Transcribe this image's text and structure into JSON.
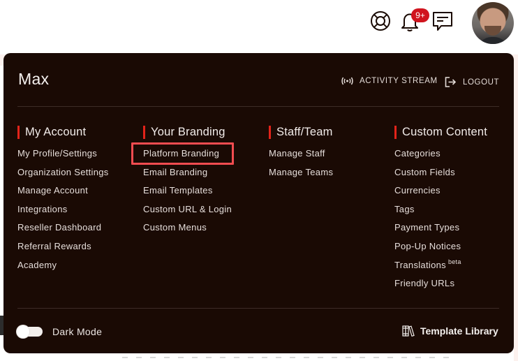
{
  "topbar": {
    "icons": {
      "support": "lifebuoy-icon",
      "notifications": "bell-icon",
      "messages": "chat-icon"
    },
    "notification_badge": "9+",
    "badge_color": "#d0141e"
  },
  "panel": {
    "user_name": "Max",
    "activity_stream_label": "ACTIVITY STREAM",
    "logout_label": "LOGOUT",
    "accent_color": "#e2231a",
    "highlight_color": "#f24c50",
    "columns": [
      {
        "title": "My Account",
        "items": [
          "My Profile/Settings",
          "Organization Settings",
          "Manage Account",
          "Integrations",
          "Reseller Dashboard",
          "Referral Rewards",
          "Academy"
        ]
      },
      {
        "title": "Your Branding",
        "items": [
          "Platform Branding",
          "Email Branding",
          "Email Templates",
          "Custom URL & Login",
          "Custom Menus"
        ],
        "highlighted_item": "Platform Branding"
      },
      {
        "title": "Staff/Team",
        "items": [
          "Manage Staff",
          "Manage Teams"
        ]
      },
      {
        "title": "Custom Content",
        "items": [
          "Categories",
          "Custom Fields",
          "Currencies",
          "Tags",
          "Payment Types",
          "Pop-Up Notices",
          "Translations",
          "Friendly URLs"
        ],
        "translations_badge": "beta"
      }
    ],
    "footer": {
      "dark_mode_label": "Dark Mode",
      "dark_mode_on": false,
      "template_library_label": "Template Library"
    }
  }
}
